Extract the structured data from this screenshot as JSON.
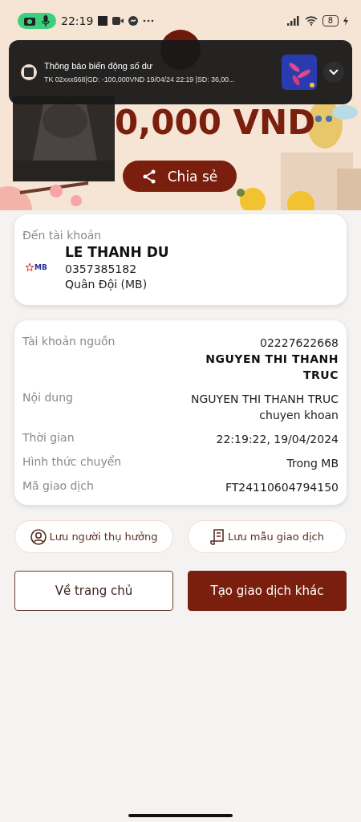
{
  "status_bar": {
    "time": "22:19",
    "battery": "8"
  },
  "notification": {
    "title": "Thông báo biến động số dư",
    "body": "TK 02xxx668|GD: -100,000VND 19/04/24 22:19 |SD: 36,00..."
  },
  "amount": "0,000 VND",
  "share_button": "Chia sẻ",
  "recipient": {
    "label": "Đến tài khoản",
    "bank_logo": "MB",
    "name": "LE THANH DU",
    "account": "0357385182",
    "bank": "Quân Đội (MB)"
  },
  "details": [
    {
      "kind": "account",
      "label": "Tài khoản nguồn",
      "value": "02227622668",
      "name": "NGUYEN THI THANH TRUC"
    },
    {
      "kind": "text",
      "label": "Nội dung",
      "value": "NGUYEN THI THANH TRUC chuyen khoan"
    },
    {
      "kind": "text",
      "label": "Thời gian",
      "value": "22:19:22, 19/04/2024"
    },
    {
      "kind": "text",
      "label": "Hình thức chuyển",
      "value": "Trong MB"
    },
    {
      "kind": "text",
      "label": "Mã giao dịch",
      "value": "FT24110604794150"
    }
  ],
  "actions": [
    {
      "kind": "person",
      "label": "Lưu người thụ hưởng"
    },
    {
      "kind": "template",
      "label": "Lưu mẫu giao dịch"
    }
  ],
  "buttons": [
    {
      "kind": "outline",
      "label": "Về trang chủ"
    },
    {
      "kind": "primary",
      "label": "Tạo giao dịch khác"
    }
  ]
}
